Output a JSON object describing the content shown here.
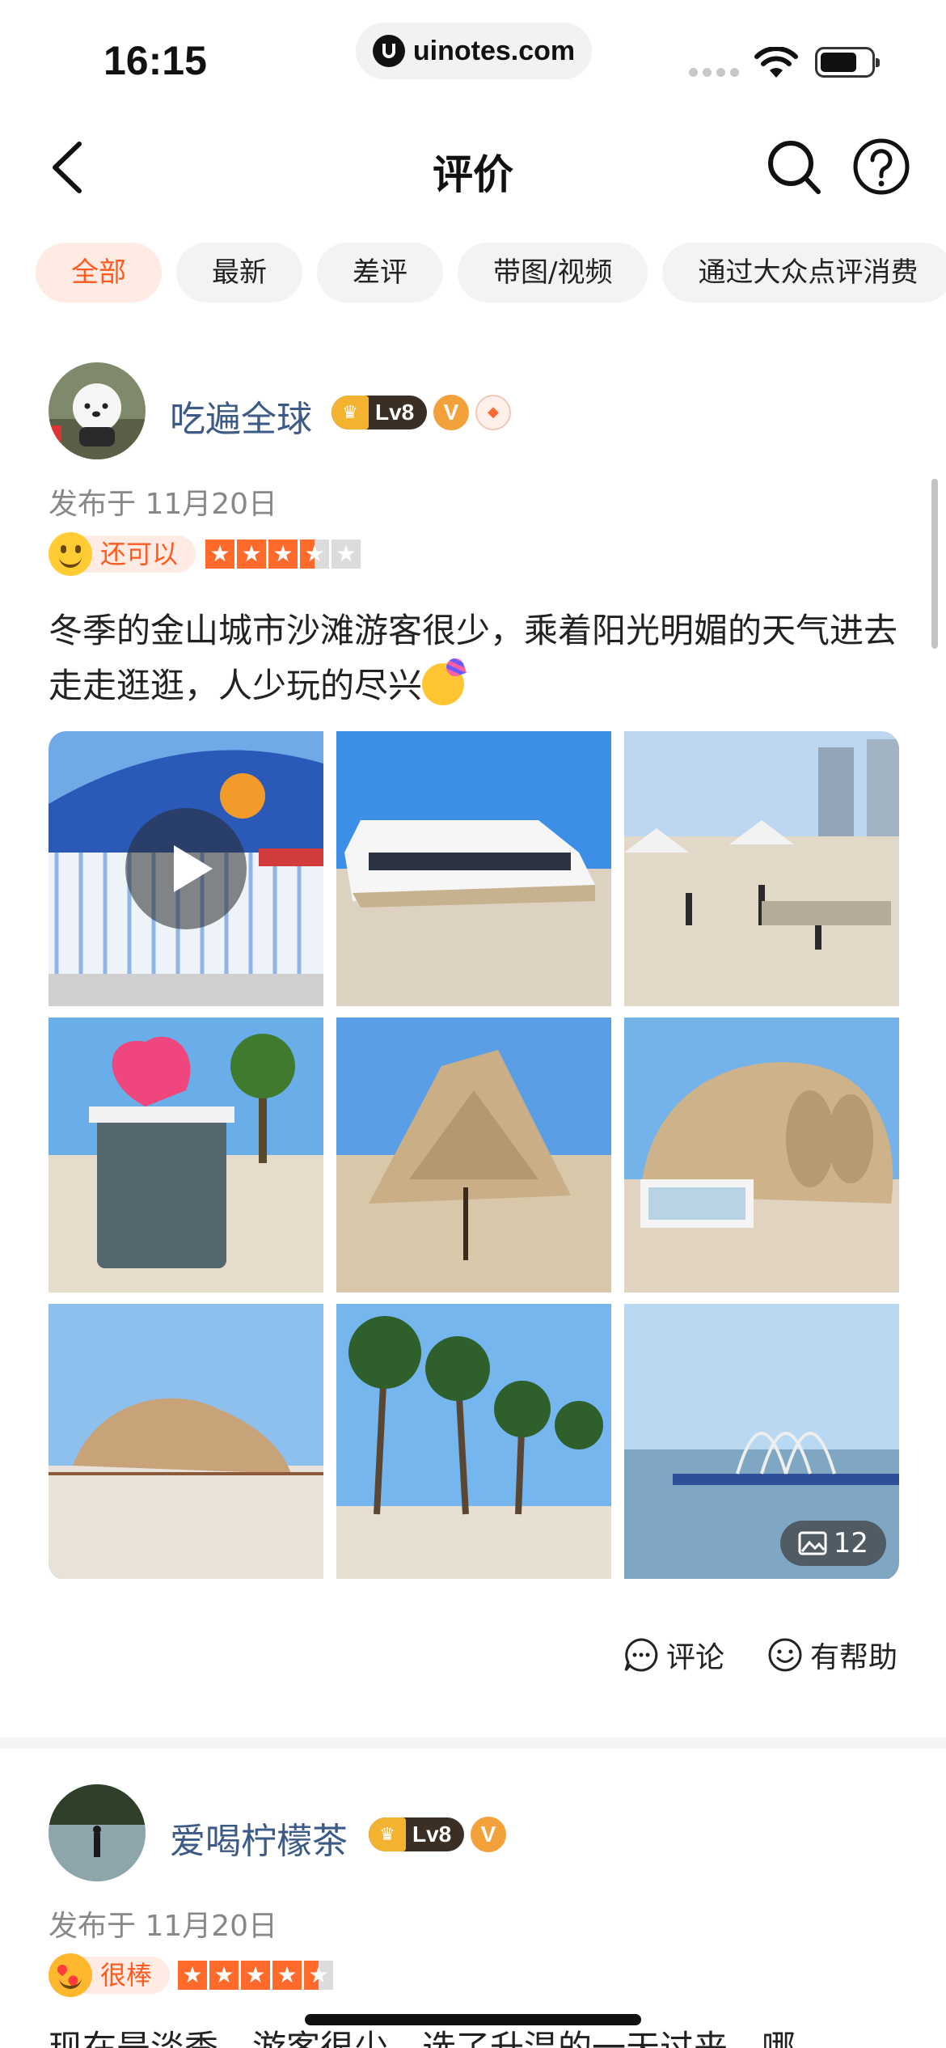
{
  "status_bar": {
    "time": "16:15",
    "url": "uinotes.com"
  },
  "nav": {
    "title": "评价"
  },
  "tabs": [
    {
      "label": "全部",
      "active": true
    },
    {
      "label": "最新",
      "active": false
    },
    {
      "label": "差评",
      "active": false
    },
    {
      "label": "带图/视频",
      "active": false
    },
    {
      "label": "通过大众点评消费",
      "active": false
    }
  ],
  "reviews": [
    {
      "username": "吃遍全球",
      "level": "Lv8",
      "verified_mark": "V",
      "date": "发布于 11月20日",
      "mood": "还可以",
      "rating": 3.5,
      "text": "冬季的金山城市沙滩游客很少，乘着阳光明媚的天气进去走走逛逛，人少玩的尽兴",
      "photo_count": "12",
      "actions": {
        "comment": "评论",
        "helpful": "有帮助"
      }
    },
    {
      "username": "爱喝柠檬茶",
      "level": "Lv8",
      "verified_mark": "V",
      "date": "发布于 11月20日",
      "mood": "很棒",
      "rating": 4.5,
      "text": "现在是淡季，游客很少，选了升温的一天过来，哪"
    }
  ],
  "colors": {
    "accent": "#ff5a1f",
    "username": "#3c5a86",
    "star": "#ff6a2a"
  }
}
